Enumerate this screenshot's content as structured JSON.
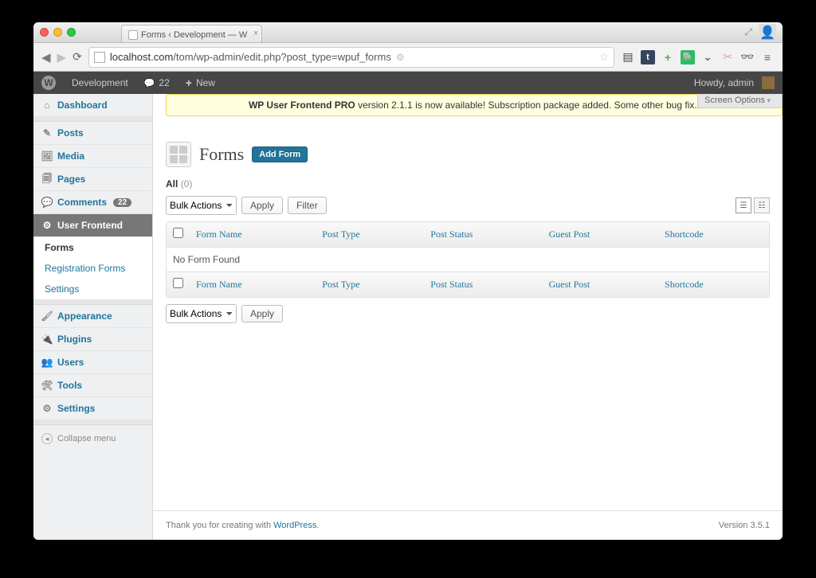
{
  "browser": {
    "tab_title": "Forms ‹ Development — W",
    "url_prefix": "localhost.com",
    "url_path": "/tom/wp-admin/edit.php?post_type=wpuf_forms"
  },
  "adminbar": {
    "site_name": "Development",
    "comments_count": "22",
    "new_label": "New",
    "howdy": "Howdy, admin"
  },
  "notice": {
    "strong": "WP User Frontend PRO",
    "rest": " version 2.1.1 is now available! Subscription package added. Some other bug fix.."
  },
  "screen_options_label": "Screen Options",
  "menu": {
    "dashboard": "Dashboard",
    "posts": "Posts",
    "media": "Media",
    "pages": "Pages",
    "comments": "Comments",
    "comments_count": "22",
    "user_frontend": "User Frontend",
    "submenu": {
      "forms": "Forms",
      "registration": "Registration Forms",
      "settings": "Settings"
    },
    "appearance": "Appearance",
    "plugins": "Plugins",
    "users": "Users",
    "tools": "Tools",
    "settings": "Settings",
    "collapse": "Collapse menu"
  },
  "page": {
    "title": "Forms",
    "add_button": "Add Form",
    "filter_all": "All",
    "filter_all_count": "(0)",
    "bulk_actions": "Bulk Actions",
    "apply_label": "Apply",
    "filter_label": "Filter",
    "no_items": "No Form Found"
  },
  "table": {
    "columns": {
      "name": "Form Name",
      "post_type": "Post Type",
      "post_status": "Post Status",
      "guest_post": "Guest Post",
      "shortcode": "Shortcode"
    }
  },
  "footer": {
    "thanks_prefix": "Thank you for creating with ",
    "wp_link": "WordPress",
    "version": "Version 3.5.1"
  }
}
